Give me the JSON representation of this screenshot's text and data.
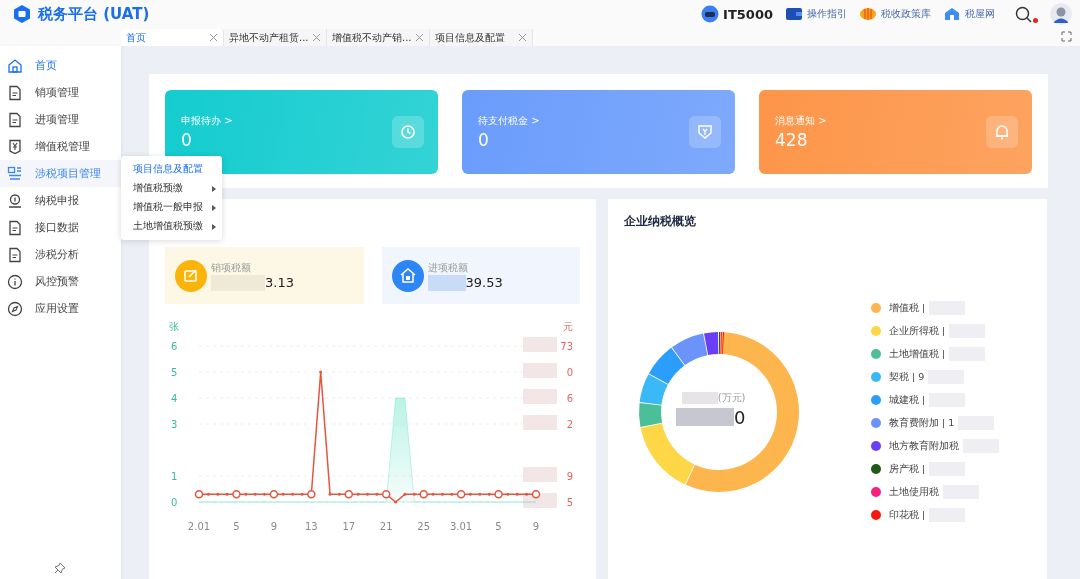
{
  "header": {
    "logo": "税务平台 (UAT)",
    "links": [
      {
        "label": "IT5000",
        "kind": "brand"
      },
      {
        "label": "操作指引",
        "kind": "guide"
      },
      {
        "label": "税收政策库",
        "kind": "policy"
      },
      {
        "label": "税屋网",
        "kind": "web"
      }
    ],
    "notification": true
  },
  "tabs": [
    {
      "label": "首页",
      "selected": true
    },
    {
      "label": "异地不动产租赁...",
      "selected": false
    },
    {
      "label": "增值税不动产销...",
      "selected": false
    },
    {
      "label": "项目信息及配置",
      "selected": false
    }
  ],
  "sidebar": {
    "items": [
      {
        "label": "首页",
        "kind": "home",
        "selected": true
      },
      {
        "label": "销项管理",
        "kind": "doc",
        "selected": false
      },
      {
        "label": "进项管理",
        "kind": "doc",
        "selected": false
      },
      {
        "label": "增值税管理",
        "kind": "yen",
        "selected": false
      },
      {
        "label": "涉税项目管理",
        "kind": "project",
        "selected": false,
        "expanded": true
      },
      {
        "label": "纳税申报",
        "kind": "declare",
        "selected": false
      },
      {
        "label": "接口数据",
        "kind": "doc",
        "selected": false
      },
      {
        "label": "涉税分析",
        "kind": "doc",
        "selected": false
      },
      {
        "label": "风控预警",
        "kind": "info",
        "selected": false
      },
      {
        "label": "应用设置",
        "kind": "compass",
        "selected": false
      }
    ]
  },
  "flyout": {
    "items": [
      {
        "label": "项目信息及配置",
        "submenu": false,
        "selected": true
      },
      {
        "label": "增值税预缴",
        "submenu": true,
        "selected": false
      },
      {
        "label": "增值税一般申报",
        "submenu": true,
        "selected": false
      },
      {
        "label": "土地增值税预缴",
        "submenu": true,
        "selected": false
      }
    ]
  },
  "summary_cards": [
    {
      "label": "申报待办 >",
      "value": "0",
      "kind": "todo",
      "color": "#14cccf"
    },
    {
      "label": "待支付税金 >",
      "value": "0",
      "kind": "pay",
      "color": "#6a9cfc"
    },
    {
      "label": "消息通知 >",
      "value": "428",
      "kind": "notice",
      "color": "#fd9548"
    }
  ],
  "tax_panel": {
    "stats": [
      {
        "label": "销项税额",
        "value": "3.13",
        "kind": "output"
      },
      {
        "label": "进项税额",
        "value": "39.53",
        "kind": "input"
      }
    ],
    "left_axis_title": "张",
    "right_axis_title": "元",
    "right_axis_labels": [
      "73",
      "0",
      "6",
      "2",
      "9",
      "5"
    ],
    "chart_data": {
      "type": "line",
      "categories": [
        "2.01",
        null,
        null,
        null,
        "5",
        null,
        null,
        null,
        "9",
        null,
        null,
        null,
        "13",
        null,
        null,
        null,
        "17",
        null,
        null,
        null,
        "21",
        null,
        null,
        null,
        "25",
        null,
        null,
        null,
        "3.01",
        null,
        null,
        null,
        "5",
        null,
        null,
        null,
        "9"
      ],
      "yticks": [
        0,
        1,
        3,
        4,
        5,
        6
      ],
      "ylim": [
        0,
        6
      ],
      "grid": true,
      "series": [
        {
          "type": "area",
          "color": "#3ddbb8",
          "values": [
            0,
            0,
            0,
            0,
            0,
            0,
            0,
            0,
            0,
            0,
            0,
            0,
            0,
            0,
            0,
            0,
            0,
            0,
            0,
            0,
            0,
            4,
            4,
            0,
            0,
            0,
            0,
            0,
            0,
            0,
            0,
            0,
            0,
            0,
            0,
            0,
            0
          ]
        },
        {
          "type": "line",
          "color": "#e5553f",
          "values": [
            0.3,
            0.3,
            0.3,
            0.3,
            0.3,
            0.3,
            0.3,
            0.3,
            0.3,
            0.3,
            0.3,
            0.3,
            0.3,
            5,
            0.3,
            0.3,
            0.3,
            0.3,
            0.3,
            0.3,
            0.3,
            0,
            0.3,
            0.3,
            0.3,
            0.3,
            0.3,
            0.3,
            0.3,
            0.3,
            0.3,
            0.3,
            0.3,
            0.3,
            0.3,
            0.3,
            0.3
          ]
        }
      ]
    }
  },
  "overview": {
    "title": "企业纳税概览",
    "center_label": "(万元)",
    "center_value": "0",
    "legend": [
      {
        "name": "增值税 |",
        "color": "#fdb64e"
      },
      {
        "name": "企业所得税 |",
        "color": "#fdd746"
      },
      {
        "name": "土地增值税 |",
        "color": "#4bbf97"
      },
      {
        "name": "契税 | 9",
        "color": "#3ab8f8"
      },
      {
        "name": "城建税 |",
        "color": "#2a9efa"
      },
      {
        "name": "教育费附加 | 1",
        "color": "#6b94fa"
      },
      {
        "name": "地方教育附加税",
        "color": "#6a3ff5"
      },
      {
        "name": "房产税 |",
        "color": "#1d5b14"
      },
      {
        "name": "土地使用税",
        "color": "#f5237e"
      },
      {
        "name": "印花税 |",
        "color": "#f7180d"
      }
    ]
  }
}
